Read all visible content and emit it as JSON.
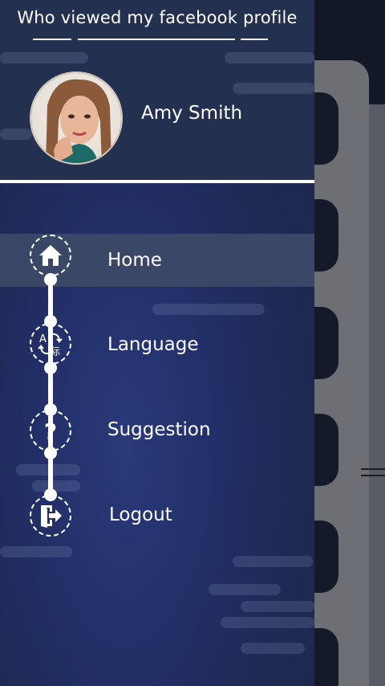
{
  "app": {
    "title": "Who viewed my facebook profile"
  },
  "profile": {
    "name": "Amy Smith"
  },
  "menu": {
    "items": [
      {
        "label": "Home",
        "icon": "home-icon",
        "active": true
      },
      {
        "label": "Language",
        "icon": "translate-icon",
        "active": false
      },
      {
        "label": "Suggestion",
        "icon": "question-icon",
        "active": false
      },
      {
        "label": "Logout",
        "icon": "logout-icon",
        "active": false
      }
    ],
    "language_glyphs": {
      "latin": "A",
      "cjk": "际"
    },
    "suggestion_glyph": "?"
  },
  "colors": {
    "drawer_header": "#24304f",
    "drawer_body": "#23306a",
    "active_item": "#3a4766",
    "text": "#ffffff",
    "background_panel": "#6d6f74"
  }
}
